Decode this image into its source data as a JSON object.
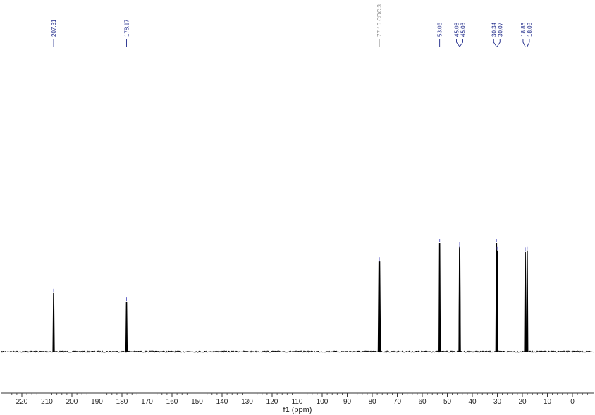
{
  "chart_data": {
    "type": "line",
    "title": "",
    "xlabel": "f1 (ppm)",
    "ylabel": "",
    "x_reversed": true,
    "xlim": [
      226,
      -8
    ],
    "ticks": [
      220,
      210,
      200,
      190,
      180,
      170,
      160,
      150,
      140,
      130,
      120,
      110,
      100,
      90,
      80,
      70,
      60,
      50,
      40,
      30,
      20,
      10,
      0
    ],
    "tick_labels": [
      "220",
      "210",
      "200",
      "190",
      "180",
      "170",
      "160",
      "150",
      "140",
      "130",
      "120",
      "110",
      "100",
      "90",
      "80",
      "70",
      "60",
      "50",
      "40",
      "30",
      "20",
      "10",
      "0"
    ],
    "grid": false,
    "baseline": 0,
    "peaks": [
      {
        "ppm": 207.31,
        "height": 0.54,
        "label": "207.31"
      },
      {
        "ppm": 178.17,
        "height": 0.46,
        "label": "178.17"
      },
      {
        "ppm": 77.16,
        "height": 0.83,
        "label": "77.16 CDCl3",
        "solvent": true
      },
      {
        "ppm": 53.06,
        "height": 1.0,
        "label": "53.06"
      },
      {
        "ppm": 45.08,
        "height": 0.97,
        "label": "45.08"
      },
      {
        "ppm": 45.03,
        "height": 0.95,
        "label": "45.03"
      },
      {
        "ppm": 30.34,
        "height": 1.0,
        "label": "30.34"
      },
      {
        "ppm": 30.07,
        "height": 0.93,
        "label": "30.07"
      },
      {
        "ppm": 18.86,
        "height": 0.92,
        "label": "18.86"
      },
      {
        "ppm": 18.08,
        "height": 0.93,
        "label": "18.08"
      }
    ]
  },
  "colors": {
    "spectrum": "#000000",
    "label": "#1f2a8a",
    "solvent_label": "#8a8a8a",
    "peak_marker": "#6a6ac8",
    "axis": "#333333"
  }
}
